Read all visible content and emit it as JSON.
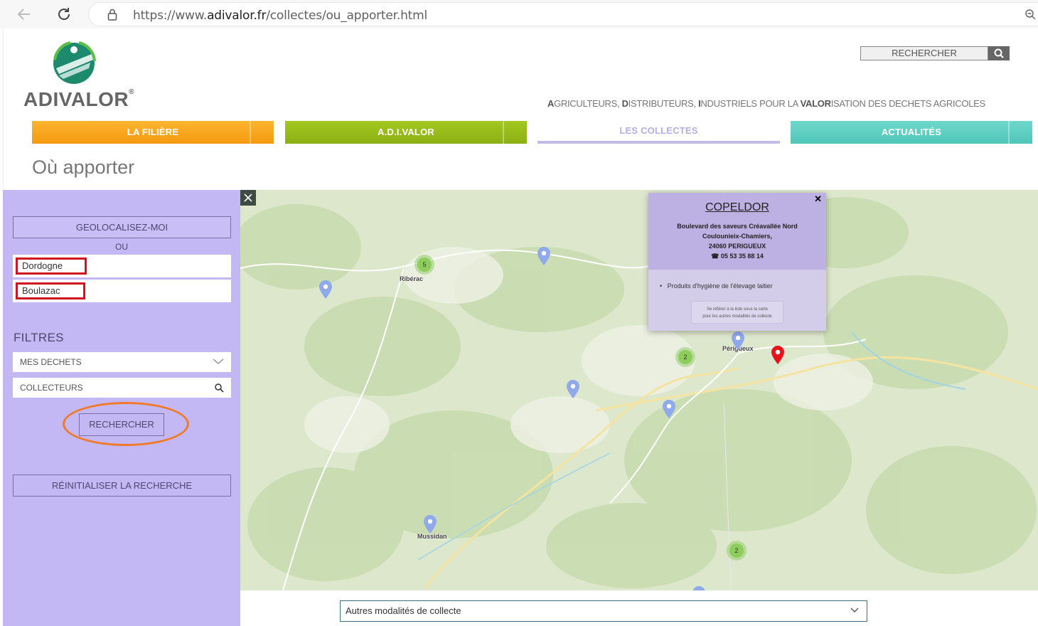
{
  "browser": {
    "url_prefix": "https://www.",
    "url_domain": "adivalor.fr",
    "url_path": "/collectes/ou_apporter.html"
  },
  "header": {
    "logo_text": "ADIVALOR",
    "logo_mark": "®",
    "search_label": "RECHERCHER",
    "tagline_parts": [
      "A",
      "GRICULTEURS, ",
      "D",
      "ISTRIBUTEURS, ",
      "I",
      "NDUSTRIELS POUR LA ",
      "VALOR",
      "ISATION DES DECHETS AGRICOLES"
    ]
  },
  "menu": {
    "filiere": "LA FILIÈRE",
    "adivalor": "A.D.I.VALOR",
    "collectes": "LES COLLECTES",
    "actualites": "ACTUALITÉS"
  },
  "page_title": "Où apporter",
  "sidebar": {
    "geo_button": "GEOLOCALISEZ-MOI",
    "or_label": "OU",
    "department": "Dordogne",
    "city": "Boulazac",
    "filters_title": "FILTRES",
    "waste_filter": "MES DECHETS",
    "collectors_filter": "COLLECTEURS",
    "search_button": "RECHERCHER",
    "reset_button": "RÉINITIALISER LA RECHERCHE"
  },
  "map": {
    "towns": [
      "Ribérac",
      "Périgueux",
      "Mussidan"
    ],
    "clusters": [
      "5",
      "2",
      "2"
    ],
    "popup": {
      "title": "COPELDOR",
      "address_1": "Boulevard des saveurs Créavallée Nord",
      "address_2": "Coulounieix-Chamiers,",
      "address_3": "24060 PERIGUEUX",
      "phone": "05 53 35 88 14",
      "product": "Produits d'hygiène de l'élevage laitier",
      "note_1": "Se référer à la liste sous la carte",
      "note_2": "pour les autres modalités de collecte"
    }
  },
  "bottom_select": "Autres modalités de collecte",
  "colors": {
    "sidebar": "#c4b8f4",
    "filiere": "#f7a51c",
    "adivalor": "#96bc18",
    "actualites": "#5ccfc1",
    "highlight_box": "#d0141f",
    "highlight_ring": "#f07a28"
  }
}
